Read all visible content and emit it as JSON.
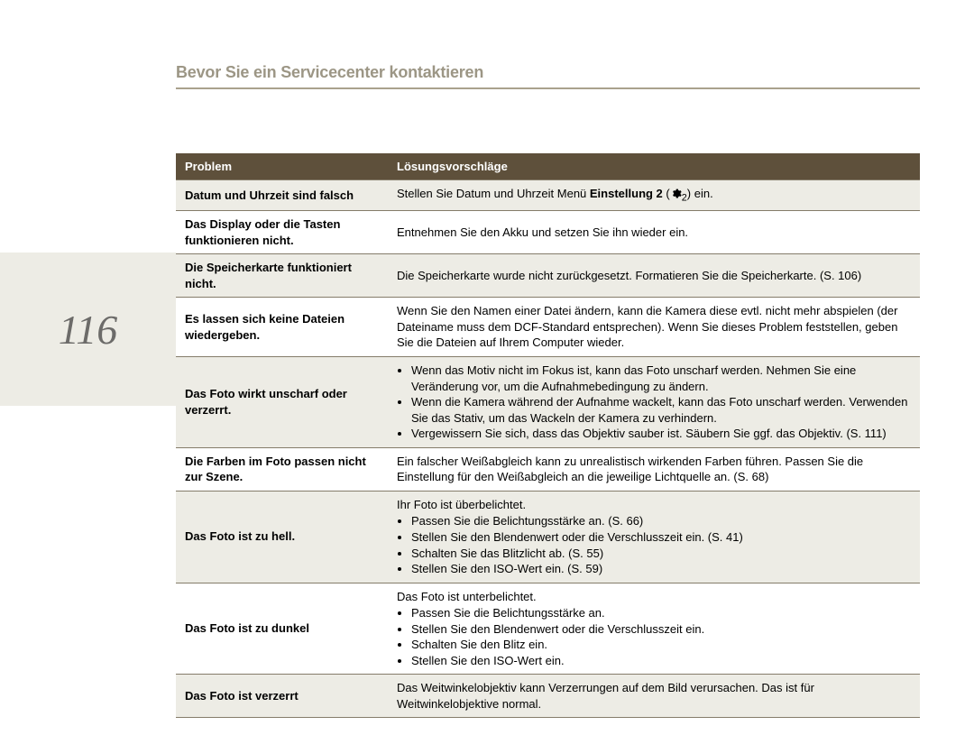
{
  "title": "Bevor Sie ein Servicecenter kontaktieren",
  "page_number": "116",
  "columns": {
    "problem": "Problem",
    "solution": "Lösungsvorschläge"
  },
  "rows": [
    {
      "problem": "Datum und Uhrzeit sind falsch",
      "solution_prefix": "Stellen Sie Datum und Uhrzeit Menü ",
      "solution_bold": "Einstellung 2",
      "solution_mid": " (",
      "gear_sub": "2",
      "solution_suffix": ") ein."
    },
    {
      "problem": "Das Display oder die Tasten funktionieren nicht.",
      "solution_text": "Entnehmen Sie den Akku und setzen Sie ihn wieder ein."
    },
    {
      "problem": "Die Speicherkarte funktioniert nicht.",
      "solution_text": "Die Speicherkarte wurde nicht zurückgesetzt. Formatieren Sie die Speicherkarte. (S. 106)"
    },
    {
      "problem": "Es lassen sich keine Dateien wiedergeben.",
      "solution_text": "Wenn Sie den Namen einer Datei ändern, kann die Kamera diese evtl. nicht mehr abspielen (der Dateiname muss dem DCF-Standard entsprechen). Wenn Sie dieses Problem feststellen, geben Sie die Dateien auf Ihrem Computer wieder."
    },
    {
      "problem": "Das Foto wirkt unscharf oder verzerrt.",
      "bullets": [
        "Wenn das Motiv nicht im Fokus ist, kann das Foto unscharf werden. Nehmen Sie eine Veränderung vor, um die Aufnahmebedingung zu ändern.",
        "Wenn die Kamera während der Aufnahme wackelt, kann das Foto unscharf werden. Verwenden Sie das Stativ, um das Wackeln der Kamera zu verhindern.",
        "Vergewissern Sie sich, dass das Objektiv sauber ist. Säubern Sie ggf. das Objektiv. (S. 111)"
      ]
    },
    {
      "problem": "Die Farben im Foto passen nicht zur  Szene.",
      "solution_text": "Ein falscher Weißabgleich kann zu unrealistisch wirkenden Farben führen. Passen Sie die Einstellung für den Weißabgleich an die jeweilige Lichtquelle an. (S. 68)"
    },
    {
      "problem": "Das Foto ist zu hell.",
      "lead": "Ihr Foto ist überbelichtet.",
      "bullets": [
        "Passen Sie die Belichtungsstärke an. (S. 66)",
        "Stellen Sie den Blendenwert oder die Verschlusszeit ein. (S. 41)",
        "Schalten Sie das Blitzlicht ab. (S. 55)",
        "Stellen Sie den ISO-Wert ein. (S. 59)"
      ]
    },
    {
      "problem": "Das Foto ist zu dunkel",
      "lead": "Das Foto ist unterbelichtet.",
      "bullets": [
        "Passen Sie die Belichtungsstärke an.",
        "Stellen Sie den Blendenwert oder die Verschlusszeit ein.",
        "Schalten Sie den Blitz ein.",
        "Stellen Sie den ISO-Wert ein."
      ]
    },
    {
      "problem": "Das Foto ist verzerrt",
      "solution_text": "Das Weitwinkelobjektiv kann Verzerrungen auf dem Bild verursachen. Das ist für Weitwinkelobjektive normal."
    }
  ]
}
